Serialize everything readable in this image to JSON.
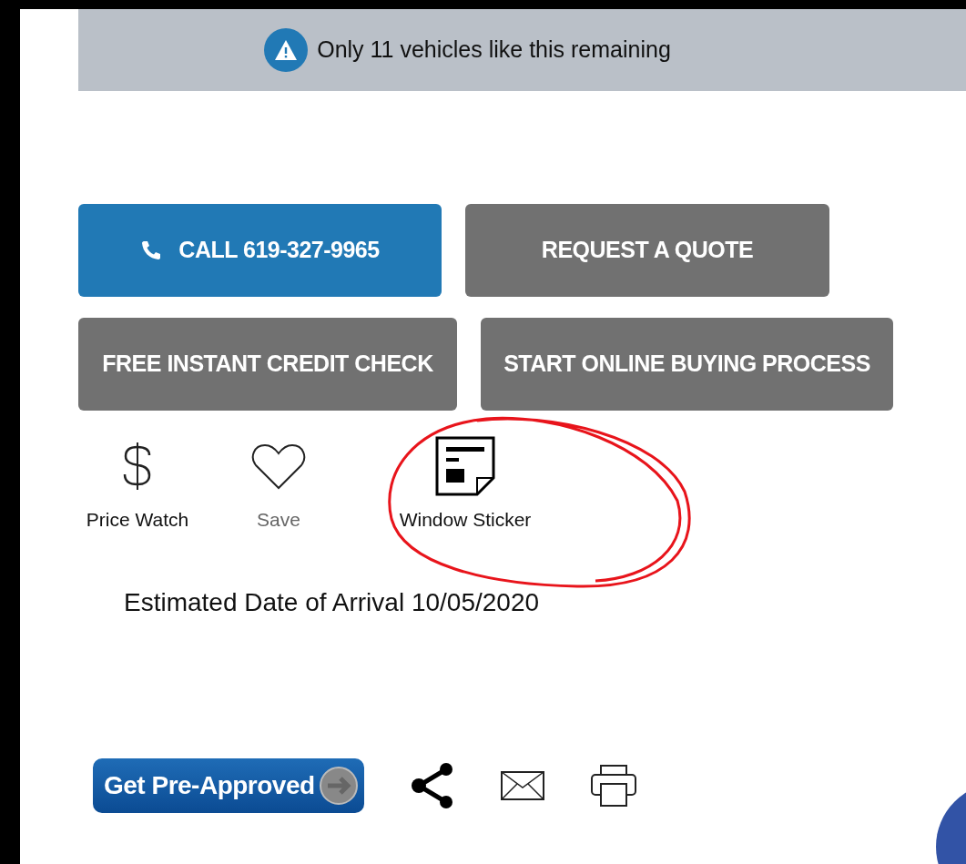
{
  "banner": {
    "text": "Only 11 vehicles like this remaining"
  },
  "buttons": [
    {
      "kind": "call",
      "label": "CALL 619-327-9965"
    },
    {
      "kind": "secondary",
      "label": "REQUEST A QUOTE"
    },
    {
      "kind": "secondary",
      "label": "FREE INSTANT CREDIT CHECK"
    },
    {
      "kind": "secondary",
      "label": "START ONLINE BUYING PROCESS"
    }
  ],
  "actions": [
    {
      "kind": "dollar",
      "label": "Price Watch",
      "disabled": false
    },
    {
      "kind": "heart",
      "label": "Save",
      "disabled": true
    },
    {
      "kind": "sticker",
      "label": "Window Sticker",
      "disabled": false,
      "circled": true
    }
  ],
  "arrival": "Estimated Date of Arrival 10/05/2020",
  "pre_approved": {
    "label": "Get Pre-Approved"
  }
}
